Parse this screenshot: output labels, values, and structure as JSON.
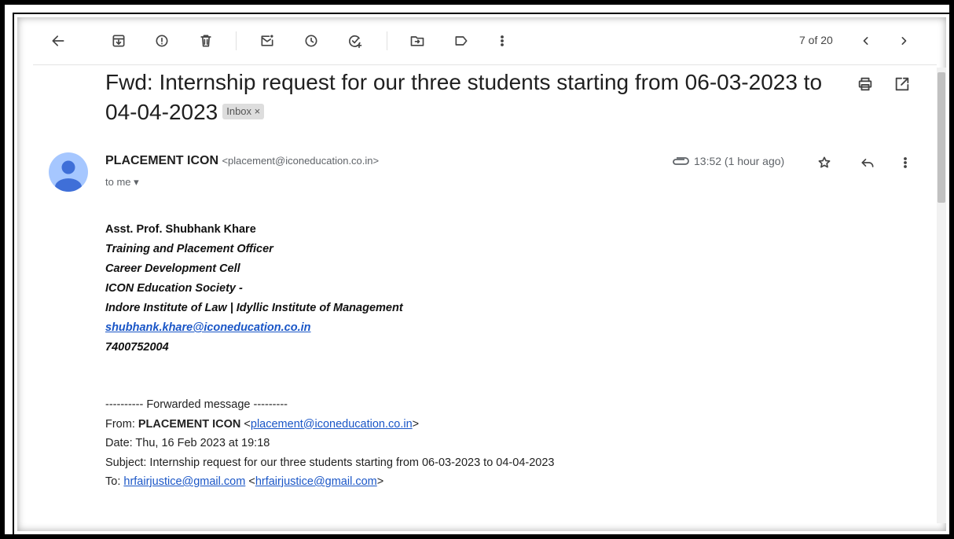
{
  "toolbar": {
    "icons": [
      "back-arrow-icon",
      "archive-icon",
      "report-spam-icon",
      "delete-icon",
      "mark-unread-icon",
      "snooze-icon",
      "add-task-icon",
      "move-to-icon",
      "label-icon",
      "more-vert-icon"
    ],
    "pager_text": "7 of 20"
  },
  "email": {
    "subject": "Fwd: Internship request for our three students starting from 06-03-2023 to 04-04-2023",
    "label_chip": "Inbox ×",
    "sender_name": "PLACEMENT ICON",
    "sender_email": "<placement@iconeducation.co.in>",
    "to": "to me ▾",
    "time": "13:52 (1 hour ago)"
  },
  "signature": {
    "name": "Asst. Prof. Shubhank Khare",
    "title": "Training and Placement Officer",
    "dept": "Career Development Cell",
    "org": "ICON Education Society -",
    "institutes": "Indore Institute of Law | Idyllic Institute of Management",
    "email": "shubhank.khare@iconeducation.co.in",
    "phone": "7400752004"
  },
  "forwarded": {
    "header": "---------- Forwarded message ---------",
    "from_label": "From: ",
    "from_name": "PLACEMENT ICON",
    "from_email": "placement@iconeducation.co.in",
    "date_line": "Date: Thu, 16 Feb 2023 at 19:18",
    "subject_line": "Subject: Internship request for our three students starting from 06-03-2023 to 04-04-2023",
    "to_label": "To: ",
    "to_email_link": "hrfairjustice@gmail.com",
    "to_email_angle": "hrfairjustice@gmail.com"
  },
  "colors": {
    "link": "#1a56c7",
    "avatar_bg": "#a6c7ff",
    "avatar_fg": "#3f6fd8"
  }
}
